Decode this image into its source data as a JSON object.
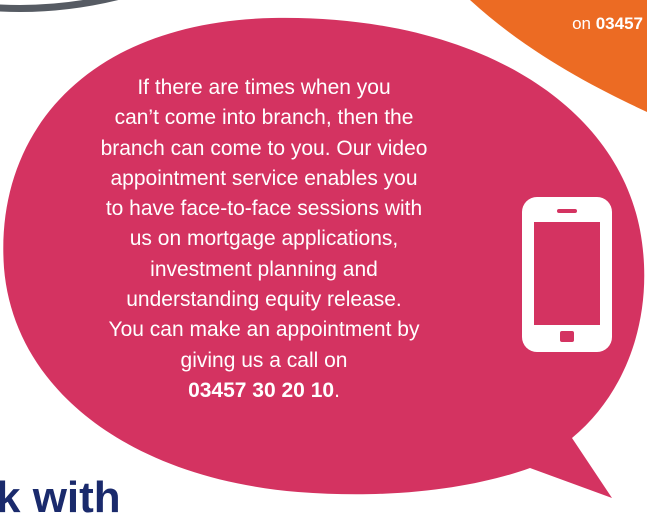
{
  "colors": {
    "bubble": "#d43361",
    "orange": "#ec6b23",
    "grey_outline": "#565b63",
    "heading": "#1a2a6c",
    "text": "#ffffff"
  },
  "orange_callout": {
    "prefix": "on ",
    "number_fragment": "03457"
  },
  "speech_bubble": {
    "lines": [
      "If there are times when you",
      "can’t come into branch, then the",
      "branch can come to you. Our video",
      "appointment service enables you",
      "to have face-to-face sessions with",
      "us on mortgage applications,",
      "investment planning and",
      "understanding equity release.",
      "You can make an appointment by",
      "giving us a call on"
    ],
    "phone_number": "03457 30 20 10",
    "phone_suffix": "."
  },
  "icons": [
    "mobile-phone-icon"
  ],
  "bottom_heading_fragment": "k with"
}
